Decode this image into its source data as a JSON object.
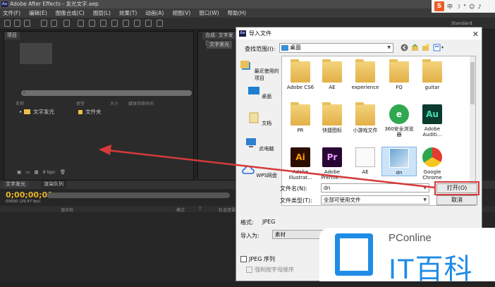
{
  "app": {
    "title": "Adobe After Effects - 发光文字.aep",
    "menu": [
      "文件(F)",
      "编辑(E)",
      "图像合成(C)",
      "图层(L)",
      "效果(T)",
      "动画(A)",
      "视图(V)",
      "窗口(W)",
      "帮助(H)"
    ],
    "workspace_label": "Standard",
    "ime": {
      "logo": "S",
      "mode": "中"
    }
  },
  "project_panel": {
    "tab_label": "项目",
    "columns": [
      "名称",
      "类型",
      "大小",
      "媒体持续时间"
    ],
    "items": [
      {
        "name": "文字发光",
        "type": "文件夹"
      }
    ],
    "footer": {
      "bpc": "8 bpc"
    }
  },
  "comp_panel": {
    "tab_label": "合成: 文字发光",
    "sub_tab": "文字发光"
  },
  "timeline": {
    "tabs": [
      "文字发光",
      "渲染队列"
    ],
    "timecode": "0;00;00;00",
    "fps": "00000 (29.97 fps)",
    "columns": [
      "源名称",
      "模式",
      "T",
      "轨道遮罩"
    ]
  },
  "dialog": {
    "title": "导入文件",
    "look_in_label": "查找范围(I):",
    "look_in_value": "桌面",
    "places": [
      "最近使用的项目",
      "桌面",
      "文档",
      "此电脑",
      "WPS网盘"
    ],
    "files": [
      {
        "name": "Adobe CS6",
        "kind": "folder"
      },
      {
        "name": "AE",
        "kind": "folder"
      },
      {
        "name": "experience",
        "kind": "folder"
      },
      {
        "name": "FQ",
        "kind": "folder"
      },
      {
        "name": "guitar",
        "kind": "folder"
      },
      {
        "name": "PR",
        "kind": "folder"
      },
      {
        "name": "快捷图标",
        "kind": "folder"
      },
      {
        "name": "小游戏文件",
        "kind": "folder"
      },
      {
        "name": "360安全浏览器",
        "kind": "app"
      },
      {
        "name": "Adobe Auditi...",
        "kind": "app"
      },
      {
        "name": "Adobe Illustrat...",
        "kind": "app"
      },
      {
        "name": "Adobe Premie...",
        "kind": "app"
      },
      {
        "name": "AE",
        "kind": "doc"
      },
      {
        "name": "dn",
        "kind": "image"
      },
      {
        "name": "Google Chrome",
        "kind": "app"
      }
    ],
    "filename_label": "文件名(N):",
    "filename_value": "dn",
    "filetype_label": "文件类型(T):",
    "filetype_value": "全部可使用文件",
    "open_button": "打开(O)",
    "cancel_button": "取消",
    "format_label": "格式:",
    "format_value": "JPEG",
    "import_as_label": "导入为:",
    "import_as_value": "素材",
    "sequence_label": "JPEG 序列",
    "alpha_order_label": "强制按字母顺序"
  },
  "watermark": {
    "brand": "PConline",
    "name": "IT百科"
  },
  "colors": {
    "accent_red": "#d63a3a",
    "ae_blue": "#1c1f47",
    "timecode": "#e8b52b",
    "wm_blue": "#1f8ce6"
  }
}
